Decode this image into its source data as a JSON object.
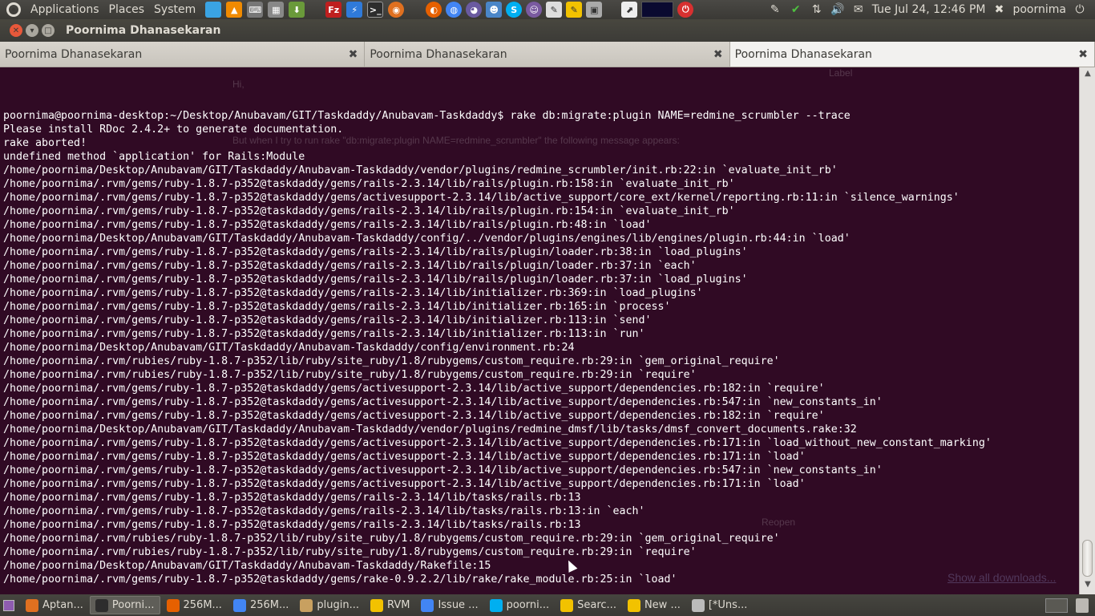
{
  "top_panel": {
    "menus": [
      "Applications",
      "Places",
      "System"
    ],
    "launchers": [
      {
        "name": "cube-icon",
        "color": "#3aa3e3"
      },
      {
        "name": "vlc-icon",
        "color": "#f08a00"
      },
      {
        "name": "keyboard-icon",
        "color": "#888"
      },
      {
        "name": "calculator-icon",
        "color": "#888"
      },
      {
        "name": "download-icon",
        "color": "#6a9a3a"
      }
    ],
    "apps": [
      {
        "name": "filezilla-icon",
        "color": "#bf1f1f",
        "glyph": "Fz"
      },
      {
        "name": "zap-icon",
        "color": "#2f7ad9",
        "glyph": "⚡"
      },
      {
        "name": "terminal-icon",
        "color": "#2d2d2d",
        "glyph": ">_"
      },
      {
        "name": "swirl-icon",
        "color": "#e07020",
        "glyph": "◉"
      }
    ],
    "tray": [
      {
        "name": "firefox-icon",
        "color": "#e66000",
        "glyph": "◐"
      },
      {
        "name": "chrome-icon",
        "color": "#4285f4",
        "glyph": "◍"
      },
      {
        "name": "pidgin-icon",
        "color": "#6a5aa0",
        "glyph": "◕"
      },
      {
        "name": "people-icon",
        "color": "#4a86c8",
        "glyph": "☻"
      },
      {
        "name": "skype-icon",
        "color": "#00aff0",
        "glyph": "S"
      },
      {
        "name": "ghost-icon",
        "color": "#7a5aa0",
        "glyph": "☺"
      },
      {
        "name": "edit-icon",
        "color": "#ddd",
        "glyph": "✎"
      },
      {
        "name": "note-icon",
        "color": "#f2c200",
        "glyph": "✎"
      },
      {
        "name": "device-icon",
        "color": "#aaa",
        "glyph": "▣"
      }
    ],
    "clock": "Tue Jul 24, 12:46 PM",
    "username": "poornima"
  },
  "window": {
    "title": "Poornima Dhanasekaran"
  },
  "tabs": [
    {
      "label": "Poornima Dhanasekaran"
    },
    {
      "label": "Poornima Dhanasekaran"
    },
    {
      "label": "Poornima Dhanasekaran"
    }
  ],
  "terminal": {
    "lines": [
      "poornima@poornima-desktop:~/Desktop/Anubavam/GIT/Taskdaddy/Anubavam-Taskdaddy$ rake db:migrate:plugin NAME=redmine_scrumbler --trace",
      "Please install RDoc 2.4.2+ to generate documentation.",
      "rake aborted!",
      "undefined method `application' for Rails:Module",
      "/home/poornima/Desktop/Anubavam/GIT/Taskdaddy/Anubavam-Taskdaddy/vendor/plugins/redmine_scrumbler/init.rb:22:in `evaluate_init_rb'",
      "/home/poornima/.rvm/gems/ruby-1.8.7-p352@taskdaddy/gems/rails-2.3.14/lib/rails/plugin.rb:158:in `evaluate_init_rb'",
      "/home/poornima/.rvm/gems/ruby-1.8.7-p352@taskdaddy/gems/activesupport-2.3.14/lib/active_support/core_ext/kernel/reporting.rb:11:in `silence_warnings'",
      "/home/poornima/.rvm/gems/ruby-1.8.7-p352@taskdaddy/gems/rails-2.3.14/lib/rails/plugin.rb:154:in `evaluate_init_rb'",
      "/home/poornima/.rvm/gems/ruby-1.8.7-p352@taskdaddy/gems/rails-2.3.14/lib/rails/plugin.rb:48:in `load'",
      "/home/poornima/Desktop/Anubavam/GIT/Taskdaddy/Anubavam-Taskdaddy/config/../vendor/plugins/engines/lib/engines/plugin.rb:44:in `load'",
      "/home/poornima/.rvm/gems/ruby-1.8.7-p352@taskdaddy/gems/rails-2.3.14/lib/rails/plugin/loader.rb:38:in `load_plugins'",
      "/home/poornima/.rvm/gems/ruby-1.8.7-p352@taskdaddy/gems/rails-2.3.14/lib/rails/plugin/loader.rb:37:in `each'",
      "/home/poornima/.rvm/gems/ruby-1.8.7-p352@taskdaddy/gems/rails-2.3.14/lib/rails/plugin/loader.rb:37:in `load_plugins'",
      "/home/poornima/.rvm/gems/ruby-1.8.7-p352@taskdaddy/gems/rails-2.3.14/lib/initializer.rb:369:in `load_plugins'",
      "/home/poornima/.rvm/gems/ruby-1.8.7-p352@taskdaddy/gems/rails-2.3.14/lib/initializer.rb:165:in `process'",
      "/home/poornima/.rvm/gems/ruby-1.8.7-p352@taskdaddy/gems/rails-2.3.14/lib/initializer.rb:113:in `send'",
      "/home/poornima/.rvm/gems/ruby-1.8.7-p352@taskdaddy/gems/rails-2.3.14/lib/initializer.rb:113:in `run'",
      "/home/poornima/Desktop/Anubavam/GIT/Taskdaddy/Anubavam-Taskdaddy/config/environment.rb:24",
      "/home/poornima/.rvm/rubies/ruby-1.8.7-p352/lib/ruby/site_ruby/1.8/rubygems/custom_require.rb:29:in `gem_original_require'",
      "/home/poornima/.rvm/rubies/ruby-1.8.7-p352/lib/ruby/site_ruby/1.8/rubygems/custom_require.rb:29:in `require'",
      "/home/poornima/.rvm/gems/ruby-1.8.7-p352@taskdaddy/gems/activesupport-2.3.14/lib/active_support/dependencies.rb:182:in `require'",
      "/home/poornima/.rvm/gems/ruby-1.8.7-p352@taskdaddy/gems/activesupport-2.3.14/lib/active_support/dependencies.rb:547:in `new_constants_in'",
      "/home/poornima/.rvm/gems/ruby-1.8.7-p352@taskdaddy/gems/activesupport-2.3.14/lib/active_support/dependencies.rb:182:in `require'",
      "/home/poornima/Desktop/Anubavam/GIT/Taskdaddy/Anubavam-Taskdaddy/vendor/plugins/redmine_dmsf/lib/tasks/dmsf_convert_documents.rake:32",
      "/home/poornima/.rvm/gems/ruby-1.8.7-p352@taskdaddy/gems/activesupport-2.3.14/lib/active_support/dependencies.rb:171:in `load_without_new_constant_marking'",
      "/home/poornima/.rvm/gems/ruby-1.8.7-p352@taskdaddy/gems/activesupport-2.3.14/lib/active_support/dependencies.rb:171:in `load'",
      "/home/poornima/.rvm/gems/ruby-1.8.7-p352@taskdaddy/gems/activesupport-2.3.14/lib/active_support/dependencies.rb:547:in `new_constants_in'",
      "/home/poornima/.rvm/gems/ruby-1.8.7-p352@taskdaddy/gems/activesupport-2.3.14/lib/active_support/dependencies.rb:171:in `load'",
      "/home/poornima/.rvm/gems/ruby-1.8.7-p352@taskdaddy/gems/rails-2.3.14/lib/tasks/rails.rb:13",
      "/home/poornima/.rvm/gems/ruby-1.8.7-p352@taskdaddy/gems/rails-2.3.14/lib/tasks/rails.rb:13:in `each'",
      "/home/poornima/.rvm/gems/ruby-1.8.7-p352@taskdaddy/gems/rails-2.3.14/lib/tasks/rails.rb:13",
      "/home/poornima/.rvm/rubies/ruby-1.8.7-p352/lib/ruby/site_ruby/1.8/rubygems/custom_require.rb:29:in `gem_original_require'",
      "/home/poornima/.rvm/rubies/ruby-1.8.7-p352/lib/ruby/site_ruby/1.8/rubygems/custom_require.rb:29:in `require'",
      "/home/poornima/Desktop/Anubavam/GIT/Taskdaddy/Anubavam-Taskdaddy/Rakefile:15",
      "/home/poornima/.rvm/gems/ruby-1.8.7-p352@taskdaddy/gems/rake-0.9.2.2/lib/rake/rake_module.rb:25:in `load'"
    ],
    "background_ghost": {
      "hi": "Hi,",
      "message": "But when I try to run rake \"db:migrate:plugin NAME=redmine_scrumbler\" the following message appears:",
      "label": "Label",
      "reopen": "Reopen",
      "show_all_downloads": "Show all downloads..."
    }
  },
  "taskbar": {
    "tasks": [
      {
        "label": "Aptan...",
        "icon": "aptana-icon",
        "color": "#e07020"
      },
      {
        "label": "Poorni...",
        "icon": "terminal-icon",
        "color": "#2d2d2d",
        "active": true
      },
      {
        "label": "256M...",
        "icon": "firefox-icon",
        "color": "#e66000"
      },
      {
        "label": "256M...",
        "icon": "chrome-icon",
        "color": "#4285f4"
      },
      {
        "label": "plugin...",
        "icon": "folder-icon",
        "color": "#c8a060"
      },
      {
        "label": "RVM",
        "icon": "note-icon",
        "color": "#f2c200"
      },
      {
        "label": "Issue ...",
        "icon": "chrome-icon",
        "color": "#4285f4"
      },
      {
        "label": "poorni...",
        "icon": "skype-icon",
        "color": "#00aff0"
      },
      {
        "label": "Searc...",
        "icon": "note-icon",
        "color": "#f2c200"
      },
      {
        "label": "New ...",
        "icon": "note-icon",
        "color": "#f2c200"
      },
      {
        "label": "[*Uns...",
        "icon": "edit-icon",
        "color": "#bbb"
      }
    ]
  }
}
